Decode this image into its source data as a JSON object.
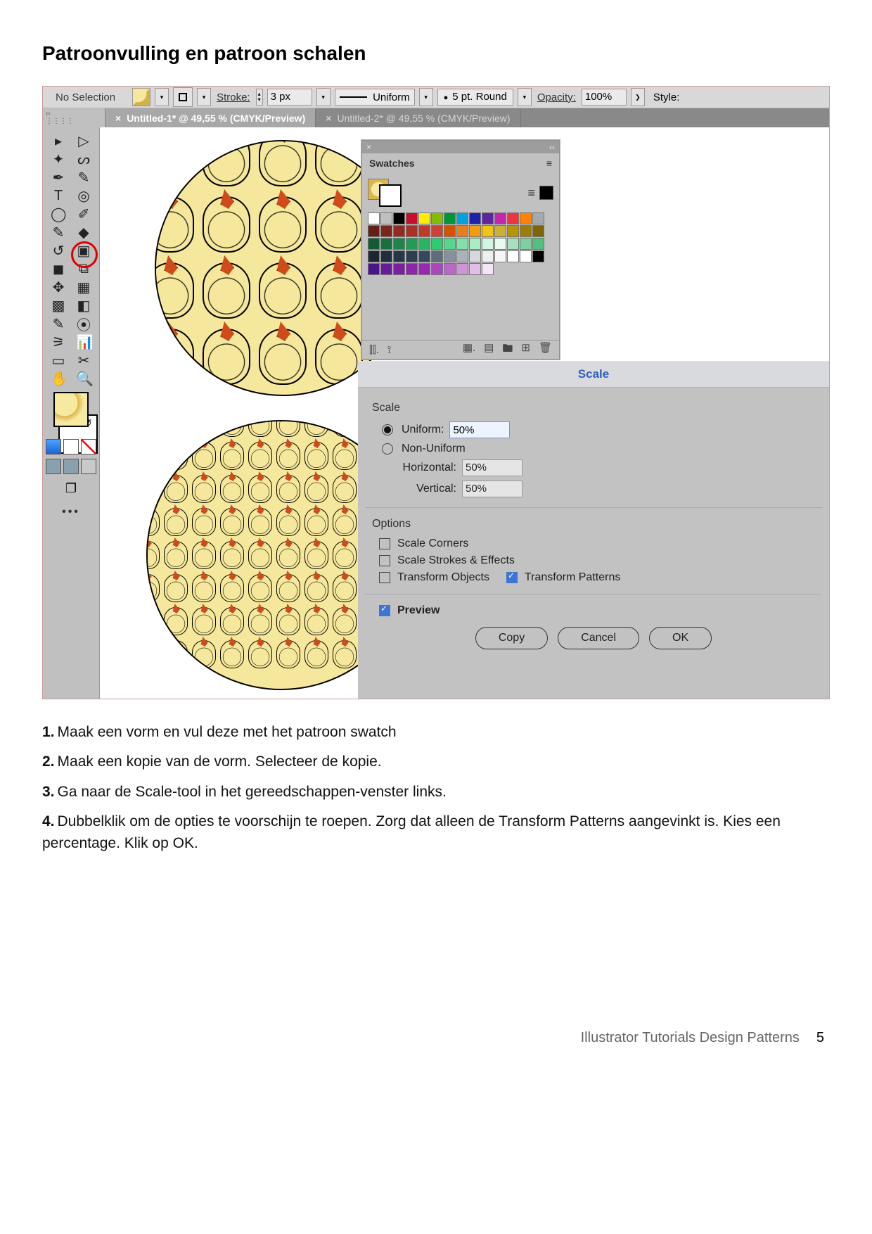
{
  "heading": "Patroonvulling en patroon schalen",
  "topbar": {
    "noSelection": "No Selection",
    "strokeLabel": "Stroke:",
    "strokeValue": "3 px",
    "uniformLabel": "Uniform",
    "roundLabel": "5 pt. Round",
    "opacityLabel": "Opacity:",
    "opacityValue": "100%",
    "styleLabel": "Style:"
  },
  "tabs": {
    "a": "Untitled-1* @ 49,55 % (CMYK/Preview)",
    "b": "Untitled-2* @ 49,55 % (CMYK/Preview)"
  },
  "swatches": {
    "title": "Swatches",
    "colors": [
      "#ffffff",
      "#bfbfbf",
      "#000000",
      "#c8102e",
      "#ffed00",
      "#84bd00",
      "#009639",
      "#00a3e0",
      "#1e22aa",
      "#5f259f",
      "#c724b1",
      "#ef3340",
      "#ff8200",
      "#a2aaad",
      "#641e16",
      "#7b241c",
      "#922b21",
      "#a93226",
      "#c0392b",
      "#cb4335",
      "#d35400",
      "#e67e22",
      "#f39c12",
      "#f1c40f",
      "#c9b037",
      "#b7950b",
      "#9a7d0a",
      "#7d6608",
      "#145a32",
      "#196f3d",
      "#1e8449",
      "#239b56",
      "#28b463",
      "#2ecc71",
      "#58d68d",
      "#82e0aa",
      "#abebc6",
      "#d5f5e3",
      "#eafaf1",
      "#a9dfbf",
      "#7dcea0",
      "#52be80",
      "#1b2631",
      "#212f3c",
      "#273746",
      "#2c3e50",
      "#34495e",
      "#5d6d7e",
      "#85929e",
      "#abb2b9",
      "#d5d8dc",
      "#ecf0f1",
      "#f4f6f7",
      "#fdfefe",
      "#fff",
      "#000",
      "#4a148c",
      "#6a1b9a",
      "#7b1fa2",
      "#8e24aa",
      "#9c27b0",
      "#ab47bc",
      "#ba68c8",
      "#ce93d8",
      "#e1bee7",
      "#f3e5f5"
    ]
  },
  "scale": {
    "title": "Scale",
    "section": "Scale",
    "uniform": "Uniform:",
    "uniformVal": "50%",
    "nonUniform": "Non-Uniform",
    "horizontal": "Horizontal:",
    "hVal": "50%",
    "vertical": "Vertical:",
    "vVal": "50%",
    "options": "Options",
    "scaleCorners": "Scale Corners",
    "scaleStrokes": "Scale Strokes & Effects",
    "transformObjects": "Transform Objects",
    "transformPatterns": "Transform Patterns",
    "preview": "Preview",
    "copy": "Copy",
    "cancel": "Cancel",
    "ok": "OK"
  },
  "steps": {
    "s1": "Maak een vorm en vul deze met het patroon swatch",
    "s2": "Maak een kopie van de vorm. Selecteer de kopie.",
    "s3": "Ga naar de Scale-tool in het gereedschappen-venster links.",
    "s4": "Dubbelklik om de opties te voorschijn te roepen. Zorg dat alleen de Transform Patterns aangevinkt is. Kies een percentage. Klik op OK."
  },
  "footer": {
    "label": "Illustrator Tutorials Design Patterns",
    "page": "5"
  }
}
